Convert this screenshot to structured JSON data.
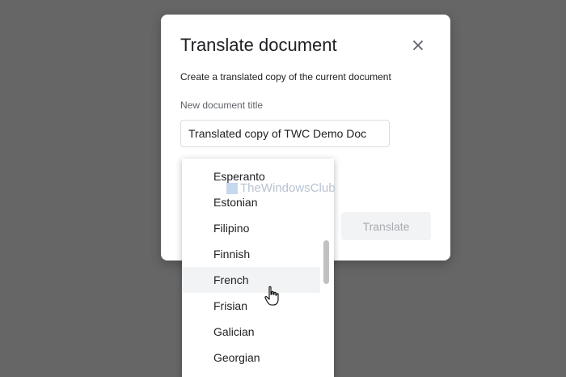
{
  "dialog": {
    "title": "Translate document",
    "description": "Create a translated copy of the current document",
    "title_field_label": "New document title",
    "title_field_value": "Translated copy of TWC Demo Doc",
    "translate_label": "Translate"
  },
  "watermark": "TheWindowsClub",
  "language_list": [
    {
      "label": "Esperanto"
    },
    {
      "label": "Estonian"
    },
    {
      "label": "Filipino"
    },
    {
      "label": "Finnish"
    },
    {
      "label": "French"
    },
    {
      "label": "Frisian"
    },
    {
      "label": "Galician"
    },
    {
      "label": "Georgian"
    }
  ],
  "selected_language": "French",
  "icons": {
    "close": "close-icon",
    "cursor": "hand-pointer-icon"
  },
  "colors": {
    "backdrop": "#666666",
    "dialog_bg": "#ffffff",
    "highlight": "#f1f3f4",
    "disabled_text": "#a8abaf"
  }
}
